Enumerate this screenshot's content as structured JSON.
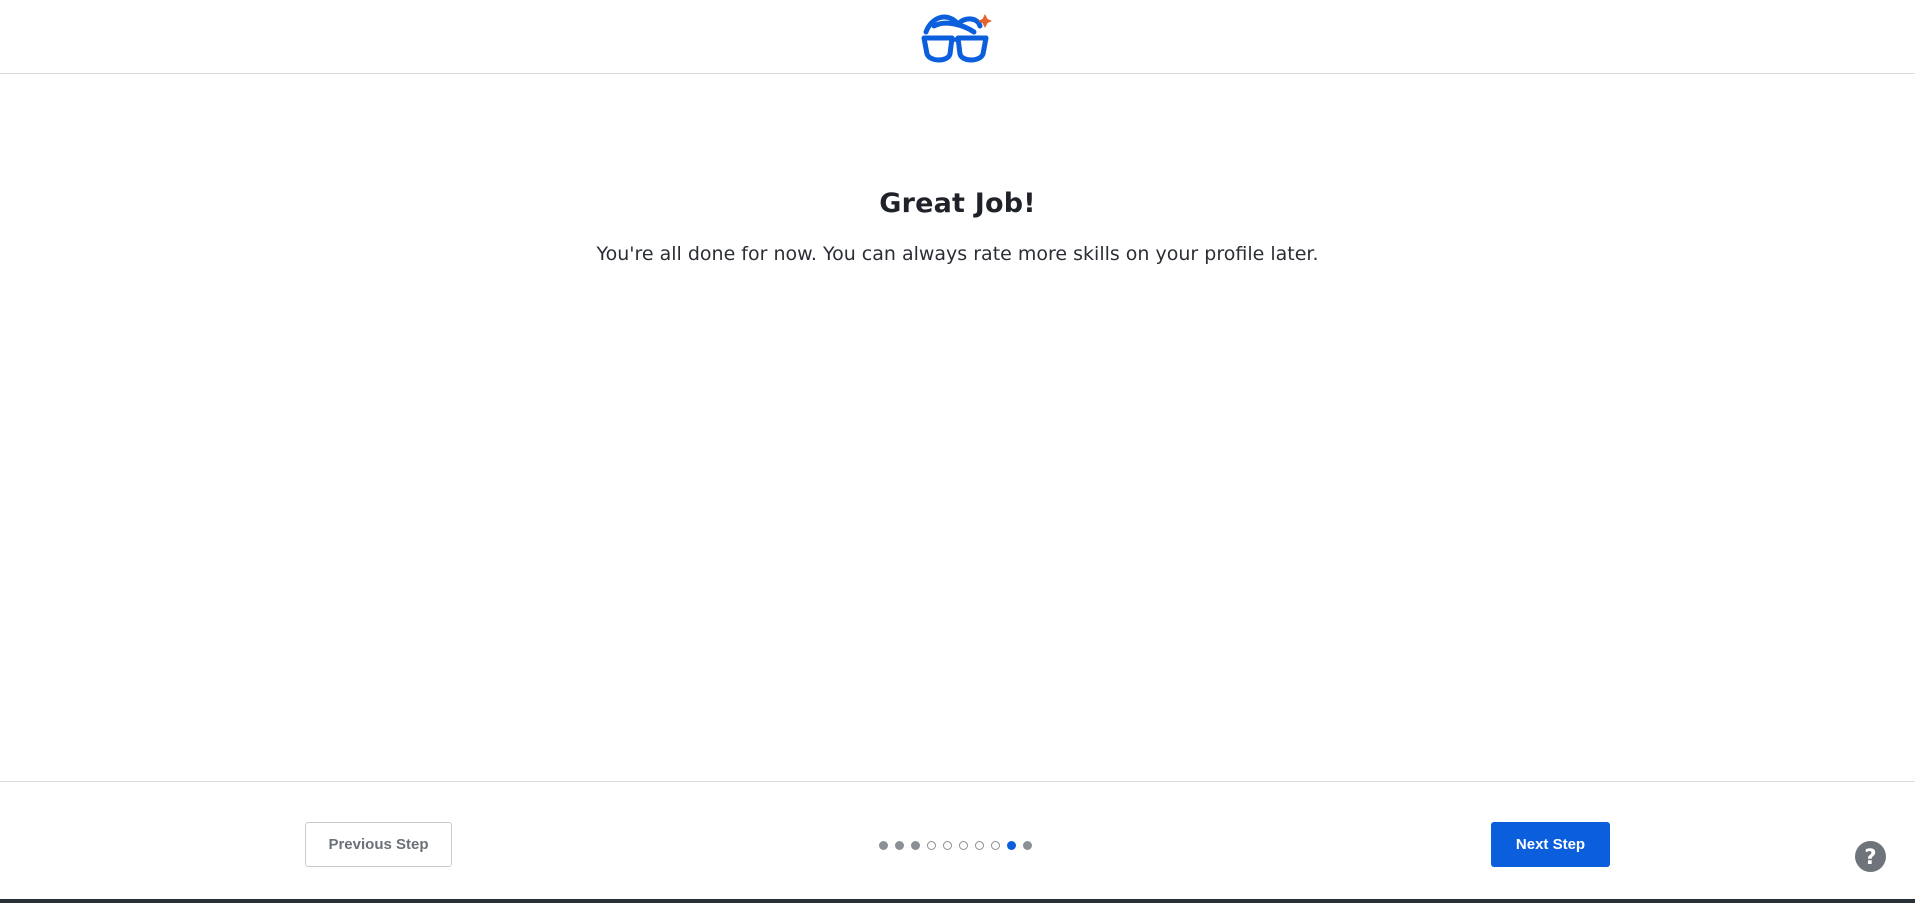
{
  "header": {
    "logo": "glasses-logo-icon",
    "colors": {
      "logo": "#0b5fdc",
      "logo_accent": "#e8622c"
    }
  },
  "main": {
    "title": "Great Job!",
    "message": "You're all done for now. You can always rate more skills on your profile later."
  },
  "footer": {
    "previous_label": "Previous Step",
    "next_label": "Next Step",
    "steps": {
      "total": 10,
      "current": 9,
      "states": [
        "done",
        "done",
        "done",
        "todo",
        "todo",
        "todo",
        "todo",
        "todo",
        "current",
        "done"
      ]
    },
    "colors": {
      "primary": "#0b5fdc",
      "dot": "#8a9096"
    }
  },
  "help": {
    "label": "?",
    "icon": "help-icon"
  }
}
